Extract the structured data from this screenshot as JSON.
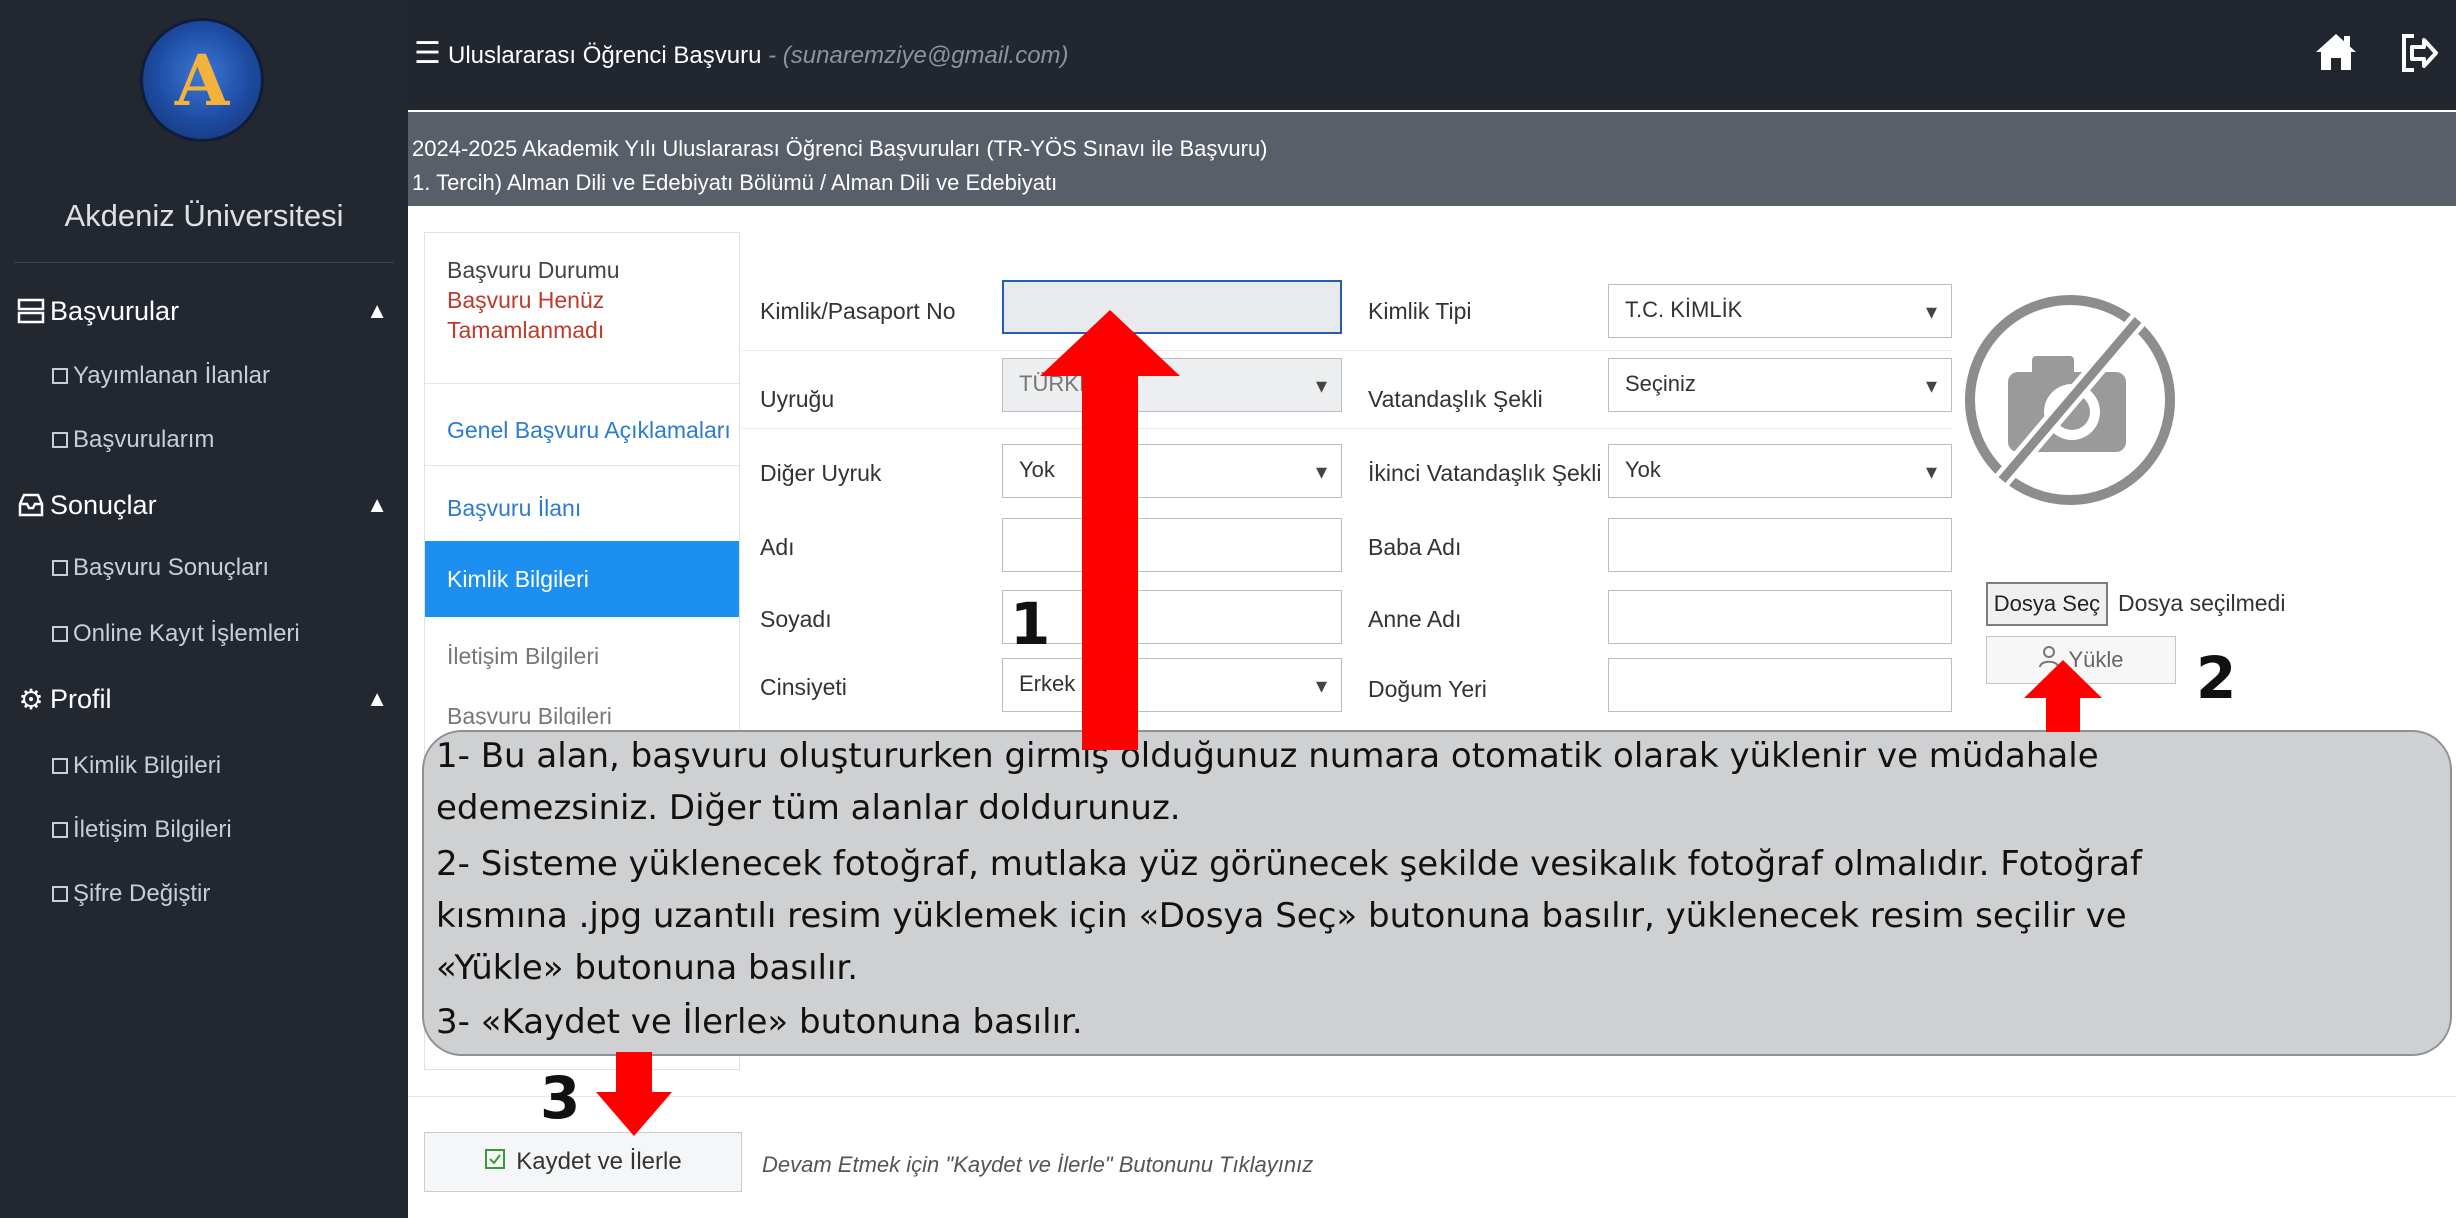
{
  "sidebar": {
    "university_name": "Akdeniz Üniversitesi",
    "sections": [
      {
        "label": "Başvurular",
        "items": [
          "Yayımlanan İlanlar",
          "Başvurularım"
        ]
      },
      {
        "label": "Sonuçlar",
        "items": [
          "Başvuru Sonuçları",
          "Online Kayıt İşlemleri"
        ]
      },
      {
        "label": "Profil",
        "items": [
          "Kimlik Bilgileri",
          "İletişim Bilgileri",
          "Şifre Değiştir"
        ]
      }
    ]
  },
  "topbar": {
    "title": "Uluslararası Öğrenci Başvuru",
    "email": " - (sunaremziye@gmail.com)",
    "icons": [
      "menu-icon",
      "home-icon",
      "exit-icon"
    ]
  },
  "heading": {
    "line1": "2024-2025 Akademik Yılı Uluslararası Öğrenci Başvuruları (TR-YÖS Sınavı ile Başvuru)",
    "line2": "1. Tercih) Alman Dili ve Edebiyatı Bölümü / Alman Dili ve Edebiyatı"
  },
  "tabs": {
    "status_title": "Başvuru Durumu",
    "status_value_1": "Başvuru Henüz",
    "status_value_2": "Tamamlanmadı",
    "items": [
      "Genel Başvuru Açıklamaları",
      "Başvuru İlanı",
      "Kimlik Bilgileri",
      "İletişim Bilgileri",
      "Başvuru Bilgileri"
    ]
  },
  "form": {
    "kimlik_no_label": "Kimlik/Pasaport No",
    "kimlik_no_value": "",
    "kimlik_tipi_label": "Kimlik Tipi",
    "kimlik_tipi_value": "T.C. KİMLİK",
    "uyrugu_label": "Uyruğu",
    "uyrugu_value": "TÜRKİYE",
    "vatandaslik_label": "Vatandaşlık Şekli",
    "vatandaslik_value": "Seçiniz",
    "diger_uyruk_label": "Diğer Uyruk",
    "diger_uyruk_value": "Yok",
    "ikinci_vat_label": "İkinci Vatandaşlık Şekli",
    "ikinci_vat_value": "Yok",
    "adi_label": "Adı",
    "adi_value": "",
    "baba_label": "Baba Adı",
    "baba_value": "",
    "soyadi_label": "Soyadı",
    "soyadi_value": "",
    "anne_label": "Anne Adı",
    "anne_value": "",
    "cinsiyet_label": "Cinsiyeti",
    "cinsiyet_value": "Erkek",
    "dogum_label": "Doğum Yeri",
    "dogum_value": ""
  },
  "photo": {
    "file_button": "Dosya Seç",
    "file_status": "Dosya seçilmedi",
    "upload_button": "Yükle"
  },
  "footer": {
    "save_button": "Kaydet ve İlerle",
    "hint": "Devam Etmek için \"Kaydet ve İlerle\" Butonunu Tıklayınız"
  },
  "callout": {
    "lines": [
      "1- Bu alan, başvuru oluştururken girmiş olduğunuz numara otomatik olarak yüklenir ve müdahale",
      "edemezsiniz. Diğer tüm alanlar doldurunuz.",
      "2- Sisteme yüklenecek fotoğraf, mutlaka yüz görünecek şekilde vesikalık fotoğraf olmalıdır. Fotoğraf",
      "kısmına .jpg uzantılı resim yüklemek için «Dosya Seç» butonuna basılır, yüklenecek resim seçilir ve",
      "«Yükle» butonuna basılır.",
      "3- «Kaydet ve İlerle» butonuna basılır."
    ]
  },
  "annotations": {
    "n1": "1",
    "n2": "2",
    "n3": "3",
    "arrow_color": "#ff0000"
  }
}
